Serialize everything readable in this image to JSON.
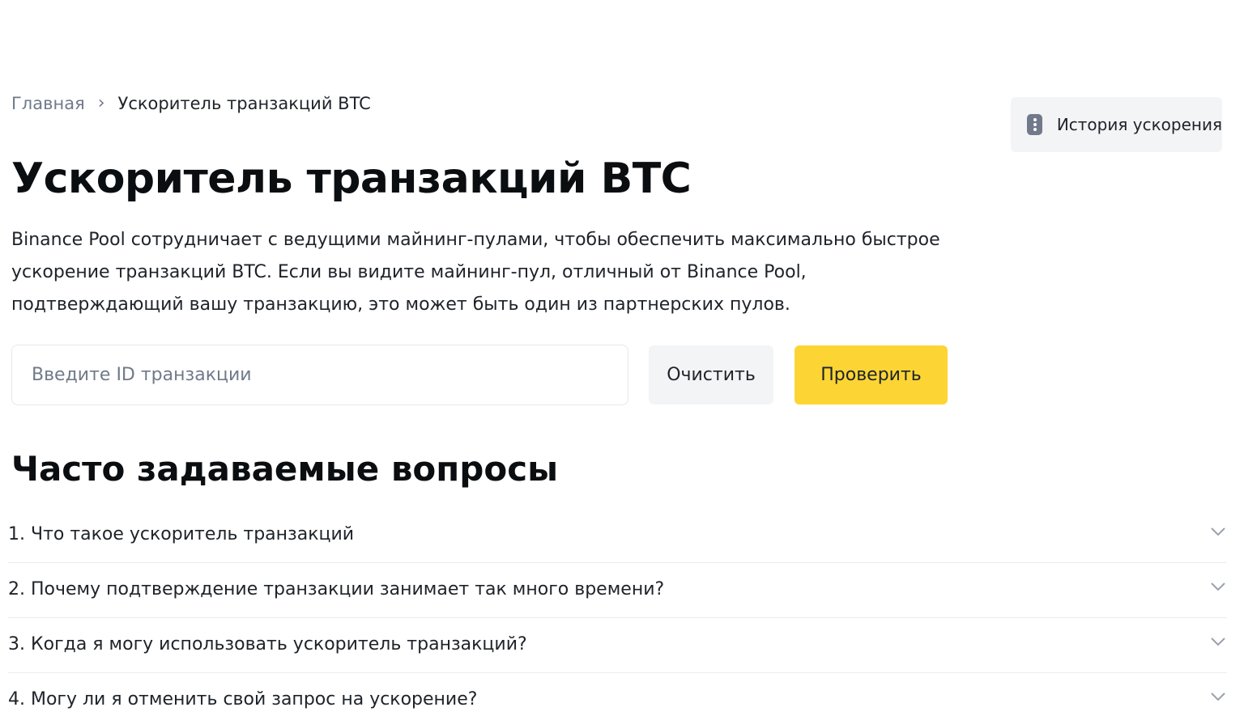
{
  "breadcrumb": {
    "home": "Главная",
    "separator": "›",
    "current": "Ускоритель транзакций BTC"
  },
  "header": {
    "history_button": "История ускорения",
    "history_icon": "history-icon"
  },
  "main": {
    "title": "Ускоритель транзакций BTC",
    "description": "Binance Pool сотрудничает с ведущими майнинг-пулами, чтобы обеспечить максимально быстрое ускорение транзакций BTC. Если вы видите майнинг-пул, отличный от Binance Pool, подтверждающий вашу транзакцию, это может быть один из партнерских пулов."
  },
  "search": {
    "placeholder": "Введите ID транзакции",
    "value": "",
    "clear_label": "Очистить",
    "check_label": "Проверить"
  },
  "faq": {
    "title": "Часто задаваемые вопросы",
    "items": [
      {
        "question": "1. Что такое ускоритель транзакций"
      },
      {
        "question": "2. Почему подтверждение транзакции занимает так много времени?"
      },
      {
        "question": "3. Когда я могу использовать ускоритель транзакций?"
      },
      {
        "question": "4. Могу ли я отменить свой запрос на ускорение?"
      }
    ],
    "expand_icon": "chevron-down-icon"
  },
  "colors": {
    "accent": "#FCD535",
    "text_primary": "#1E2329",
    "text_secondary": "#707A8A",
    "button_secondary": "#F3F4F6"
  }
}
